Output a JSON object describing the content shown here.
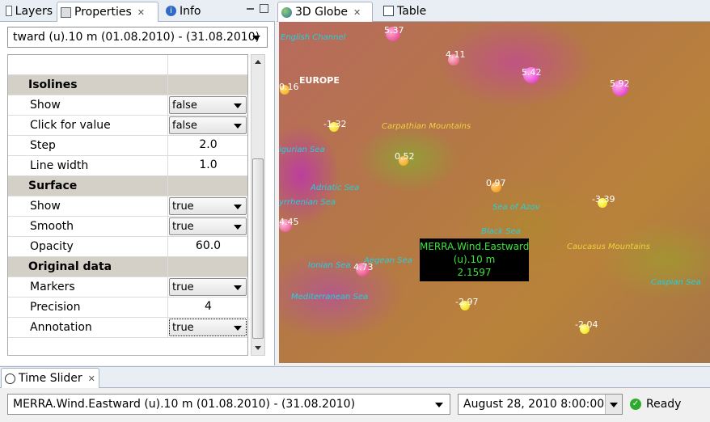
{
  "left_tabs": [
    {
      "label": "Layers",
      "icon": "layers-icon"
    },
    {
      "label": "Properties",
      "icon": "properties-icon"
    },
    {
      "label": "Info",
      "icon": "info-icon"
    }
  ],
  "layer_select": {
    "value": "tward (u).10 m  (01.08.2010)  -  (31.08.2010)"
  },
  "properties": {
    "isolines": {
      "label": "Isolines",
      "show": {
        "label": "Show",
        "value": "false"
      },
      "click_for_value": {
        "label": "Click for value",
        "value": "false"
      },
      "step": {
        "label": "Step",
        "value": "2.0"
      },
      "line_width": {
        "label": "Line width",
        "value": "1.0"
      }
    },
    "surface": {
      "label": "Surface",
      "show": {
        "label": "Show",
        "value": "true"
      },
      "smooth": {
        "label": "Smooth",
        "value": "true"
      },
      "opacity": {
        "label": "Opacity",
        "value": "60.0"
      }
    },
    "original_data": {
      "label": "Original data",
      "markers": {
        "label": "Markers",
        "value": "true"
      },
      "precision": {
        "label": "Precision",
        "value": "4"
      },
      "annotation": {
        "label": "Annotation",
        "value": "true"
      }
    }
  },
  "right_tabs": [
    {
      "label": "3D Globe",
      "icon": "globe-icon"
    },
    {
      "label": "Table",
      "icon": "table-icon"
    }
  ],
  "map": {
    "places": {
      "english_channel": "English Channel",
      "europe": "EUROPE",
      "carpathian": "Carpathian Mountains",
      "ligurian": "igurian Sea",
      "adriatic": "Adriatic Sea",
      "tyrrhenian": "yrrhenian Sea",
      "azov": "Sea of Azov",
      "black": "Black Sea",
      "caucasus": "Caucasus Mountains",
      "ionian": "Ionian Sea",
      "aegean": "Aegean Sea",
      "caspian": "Caspian Sea",
      "mediterranean": "Mediterranean Sea"
    },
    "markers": [
      "5.37",
      "4.11",
      "5.42",
      "5.92",
      "0.16",
      "-1.32",
      "0.52",
      "0.97",
      "-3.39",
      "4.45",
      "4.73",
      "-2.97",
      "-2.04"
    ],
    "tooltip": {
      "line1": "MERRA.Wind.Eastward",
      "line2": "(u).10 m",
      "line3": "2.1597"
    }
  },
  "time_slider": {
    "tab_label": "Time Slider",
    "dataset": "MERRA.Wind.Eastward (u).10 m  (01.08.2010)  -  (31.08.2010)",
    "date": "August 28, 2010 8:00:00 PM",
    "status": "Ready"
  }
}
